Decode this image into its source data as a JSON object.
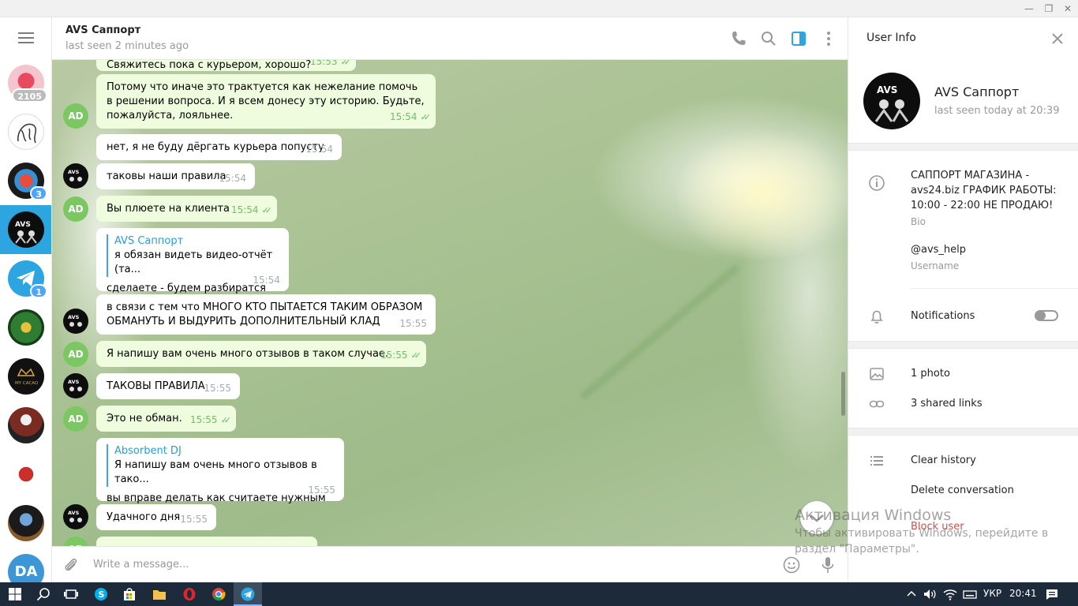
{
  "window": {
    "minimize": "—",
    "restore": "❐",
    "close": "✕"
  },
  "sidebar": {
    "chats": [
      {
        "name": "chat-1",
        "badge": "2105",
        "badge_muted": true
      },
      {
        "name": "chat-2",
        "badge": ""
      },
      {
        "name": "chat-3",
        "badge": "3",
        "badge_muted": false
      },
      {
        "name": "avs-support",
        "badge": ""
      },
      {
        "name": "telegram",
        "badge": "1",
        "badge_muted": false
      },
      {
        "name": "chat-6",
        "badge": ""
      },
      {
        "name": "my-cacao",
        "badge": ""
      },
      {
        "name": "one-shot",
        "badge": ""
      },
      {
        "name": "chat-9",
        "badge": ""
      },
      {
        "name": "chat-10",
        "badge": ""
      }
    ],
    "self_initials": "DA"
  },
  "header": {
    "title": "AVS Саппорт",
    "status": "last seen 2 minutes ago"
  },
  "messages": [
    {
      "text": "Свяжитесь пока с курьером, хорошо?",
      "time": "15:53",
      "out": true
    },
    {
      "text": "Потому что иначе это трактуется как нежелание помочь в решении вопроса. И я всем донесу эту историю. Будьте, пожалуйста, лояльнее.",
      "time": "15:54",
      "out": true,
      "avatar": "AD"
    },
    {
      "text": "нет, я не буду дёргать курьера попусту",
      "time": "15:54",
      "out": false
    },
    {
      "text": "таковы наши правила",
      "time": "15:54",
      "out": false
    },
    {
      "text": "Вы плюете на клиента",
      "time": "15:54",
      "out": true,
      "avatar": "AD"
    },
    {
      "reply_name": "AVS Саппорт",
      "reply_text": "я обязан видеть видео-отчёт (та...",
      "text": "сделаете - будем разбиратся",
      "time": "15:54",
      "out": false
    },
    {
      "text": "в связи с тем что МНОГО КТО ПЫТАЕТСЯ ТАКИМ ОБРАЗОМ ОБМАНУТЬ И ВЫДУРИТЬ ДОПОЛНИТЕЛЬНЫЙ КЛАД",
      "time": "15:55",
      "out": false
    },
    {
      "text": "Я напишу вам очень много отзывов в таком случае.",
      "time": "15:55",
      "out": true,
      "avatar": "AD"
    },
    {
      "text": "ТАКОВЫ ПРАВИЛА",
      "time": "15:55",
      "out": false
    },
    {
      "text": "Это не обман.",
      "time": "15:55",
      "out": true,
      "avatar": "AD"
    },
    {
      "reply_name": "Absorbent DJ",
      "reply_text": "Я напишу вам очень много отзывов в тако...",
      "text": "вы вправе делать как считаете нужным",
      "time": "15:55",
      "out": false
    },
    {
      "text": "Удачного дня",
      "time": "15:55",
      "out": false
    }
  ],
  "ad_initials": "AD",
  "composer": {
    "placeholder": "Write a message..."
  },
  "user_info": {
    "title": "User Info",
    "name": "AVS Саппорт",
    "last_seen": "last seen today at 20:39",
    "bio": "САППОРТ МАГАЗИНА - avs24.biz ГРАФИК РАБОТЫ: 10:00 - 22:00 НЕ ПРОДАЮ!",
    "bio_label": "Bio",
    "username": "@avs_help",
    "username_label": "Username",
    "notifications": "Notifications",
    "notifications_on": false,
    "photos": "1 photo",
    "links": "3 shared links",
    "clear_history": "Clear history",
    "delete_conversation": "Delete conversation",
    "block_user": "Block user"
  },
  "watermark": {
    "title": "Активация Windows",
    "text": "Чтобы активировать Windows, перейдите в раздел \"Параметры\"."
  },
  "taskbar": {
    "lang": "УКР",
    "time": "20:41"
  },
  "colors": {
    "accent": "#2ca5e0",
    "outgoing": "#effdde",
    "danger": "#d14e4e"
  }
}
